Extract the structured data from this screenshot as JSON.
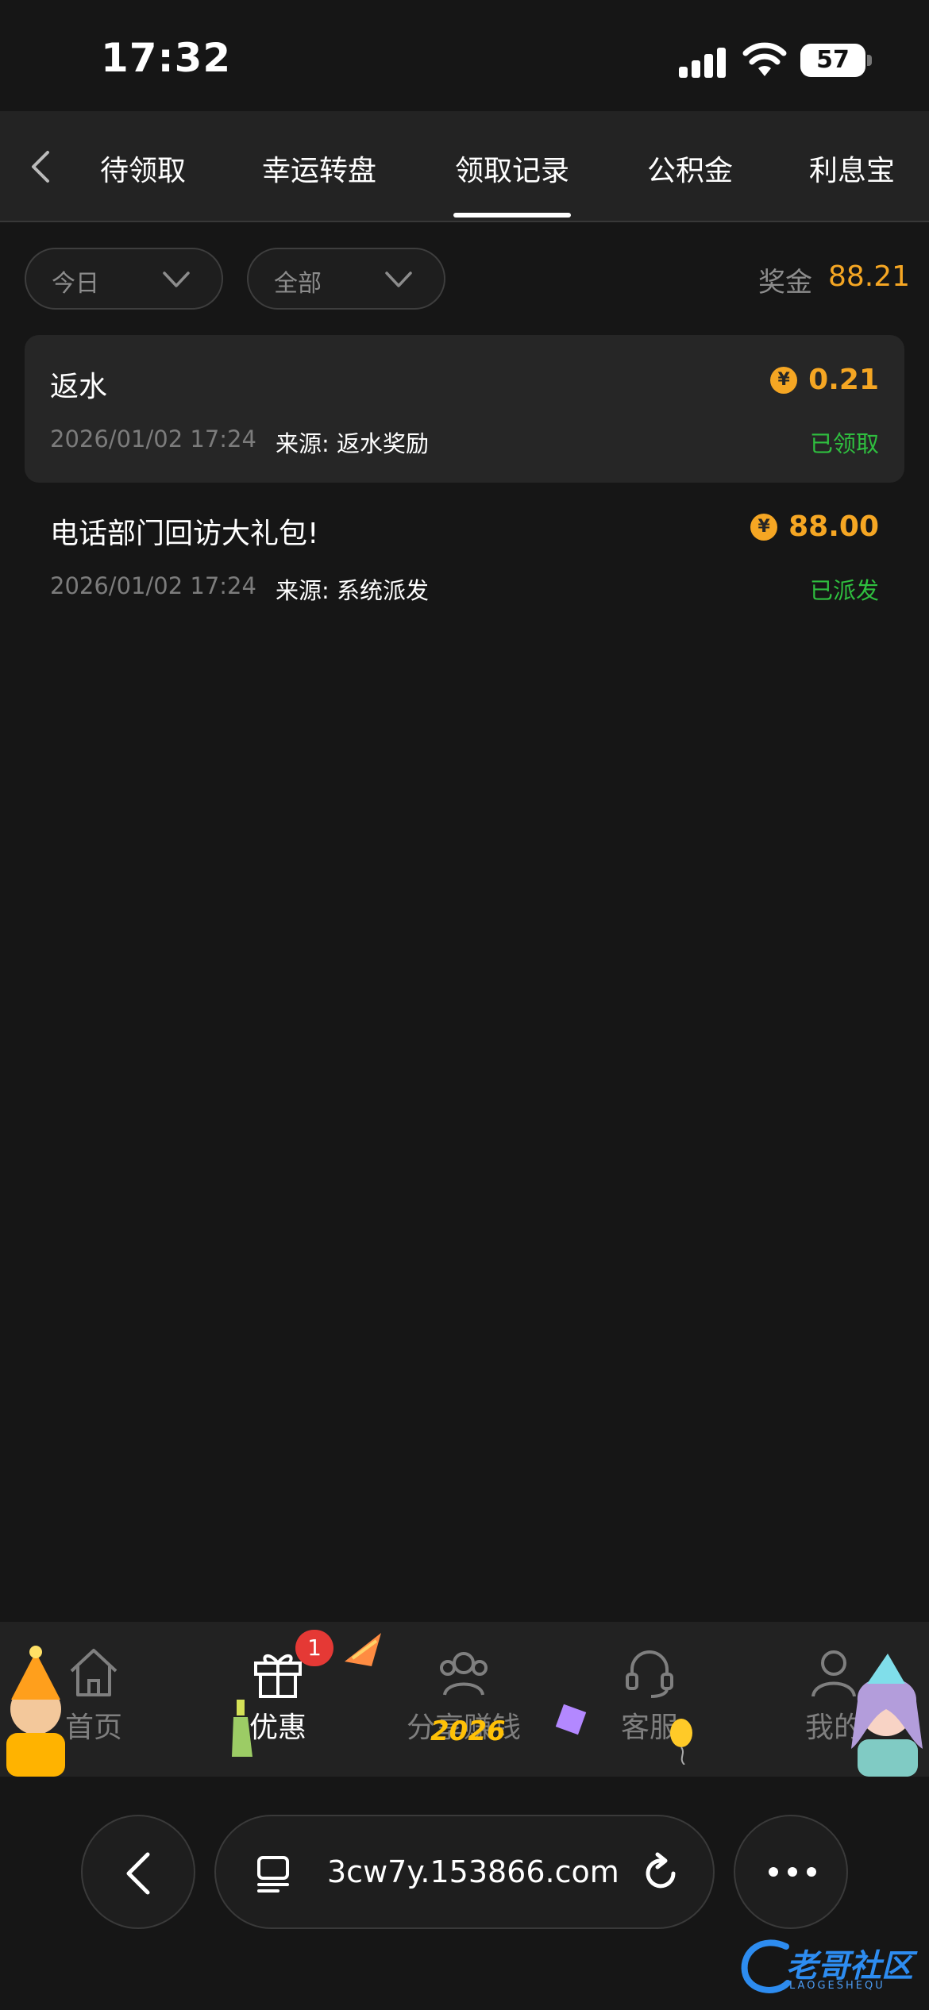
{
  "status_bar": {
    "time": "17:32",
    "battery": "57"
  },
  "tabs": [
    {
      "label": "待领取"
    },
    {
      "label": "幸运转盘"
    },
    {
      "label": "领取记录"
    },
    {
      "label": "公积金"
    },
    {
      "label": "利息宝"
    }
  ],
  "active_tab": "领取记录",
  "filters": {
    "date": "今日",
    "type": "全部"
  },
  "prize": {
    "label": "奖金",
    "value": "88.21"
  },
  "records": [
    {
      "title": "返水",
      "amount": "0.21",
      "date": "2026/01/02 17:24",
      "source": "来源: 返水奖励",
      "status": "已领取",
      "coin_symbol": "¥"
    },
    {
      "title": "电话部门回访大礼包!",
      "amount": "88.00",
      "date": "2026/01/02 17:24",
      "source": "来源: 系统派发",
      "status": "已派发",
      "coin_symbol": "¥"
    }
  ],
  "bottom_nav": [
    {
      "label": "首页",
      "icon": "home-icon"
    },
    {
      "label": "优惠",
      "icon": "gift-icon",
      "badge": "1"
    },
    {
      "label": "分享赚钱",
      "icon": "share-icon"
    },
    {
      "label": "客服",
      "icon": "headset-icon"
    },
    {
      "label": "我的",
      "icon": "user-icon"
    }
  ],
  "decoration_text": "2026",
  "browser": {
    "url": "3cw7y.153866.com"
  },
  "watermark": {
    "text": "老哥社区",
    "sub": "LAOGESHEQU"
  },
  "colors": {
    "accent": "#f5a623",
    "success": "#2fbf3f",
    "badge": "#e53935",
    "background": "#161616"
  }
}
